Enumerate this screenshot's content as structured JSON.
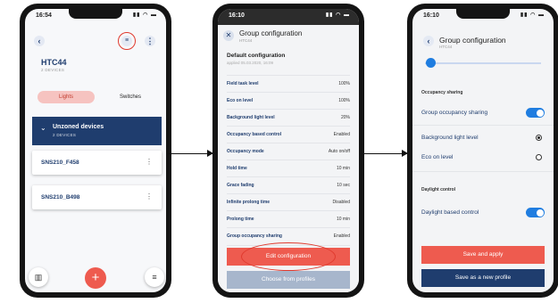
{
  "phone1": {
    "time": "16:54",
    "back_glyph": "‹",
    "title": "HTC44",
    "subtitle": "2 DEVICES",
    "tabs": [
      "Lights",
      "Switches"
    ],
    "group": {
      "name": "Unzoned devices",
      "count": "2 DEVICES"
    },
    "devices": [
      "SNS210_F458",
      "SNS210_B498"
    ],
    "fab_label": "+",
    "more_glyph": "⋮"
  },
  "phone2": {
    "time": "16:10",
    "title": "Group configuration",
    "subtitle": "HTC44",
    "default_title": "Default configuration",
    "default_sub": "applied 05.03.2020, 16:09",
    "params": [
      {
        "name": "Field task level",
        "value": "100%"
      },
      {
        "name": "Eco on level",
        "value": "100%"
      },
      {
        "name": "Background light level",
        "value": "20%"
      },
      {
        "name": "Occupancy based control",
        "value": "Enabled"
      },
      {
        "name": "Occupancy mode",
        "value": "Auto on/off"
      },
      {
        "name": "Hold time",
        "value": "10 min"
      },
      {
        "name": "Grace fading",
        "value": "10 sec"
      },
      {
        "name": "Infinite prolong time",
        "value": "Disabled"
      },
      {
        "name": "Prolong time",
        "value": "10 min"
      },
      {
        "name": "Group occupancy sharing",
        "value": "Enabled"
      }
    ],
    "edit_label": "Edit configuration",
    "choose_label": "Choose from profiles"
  },
  "phone3": {
    "time": "16:10",
    "title": "Group configuration",
    "subtitle": "HTC44",
    "occupancy_header": "Occupancy sharing",
    "group_sharing_label": "Group occupancy sharing",
    "background_label": "Background light level",
    "eco_label": "Eco on level",
    "daylight_header": "Daylight control",
    "daylight_label": "Daylight based control",
    "save_label": "Save and apply",
    "save_profile_label": "Save as a new profile"
  },
  "colors": {
    "navy": "#1f3d6e",
    "accent_red": "#ee5b4f",
    "toggle_blue": "#1f7de0",
    "muted_button": "#a7b6cc"
  },
  "icons": [
    "back-icon",
    "filter-icon",
    "more-icon",
    "chevron-down-icon",
    "close-icon",
    "building-icon",
    "menu-icon",
    "plus-icon"
  ]
}
